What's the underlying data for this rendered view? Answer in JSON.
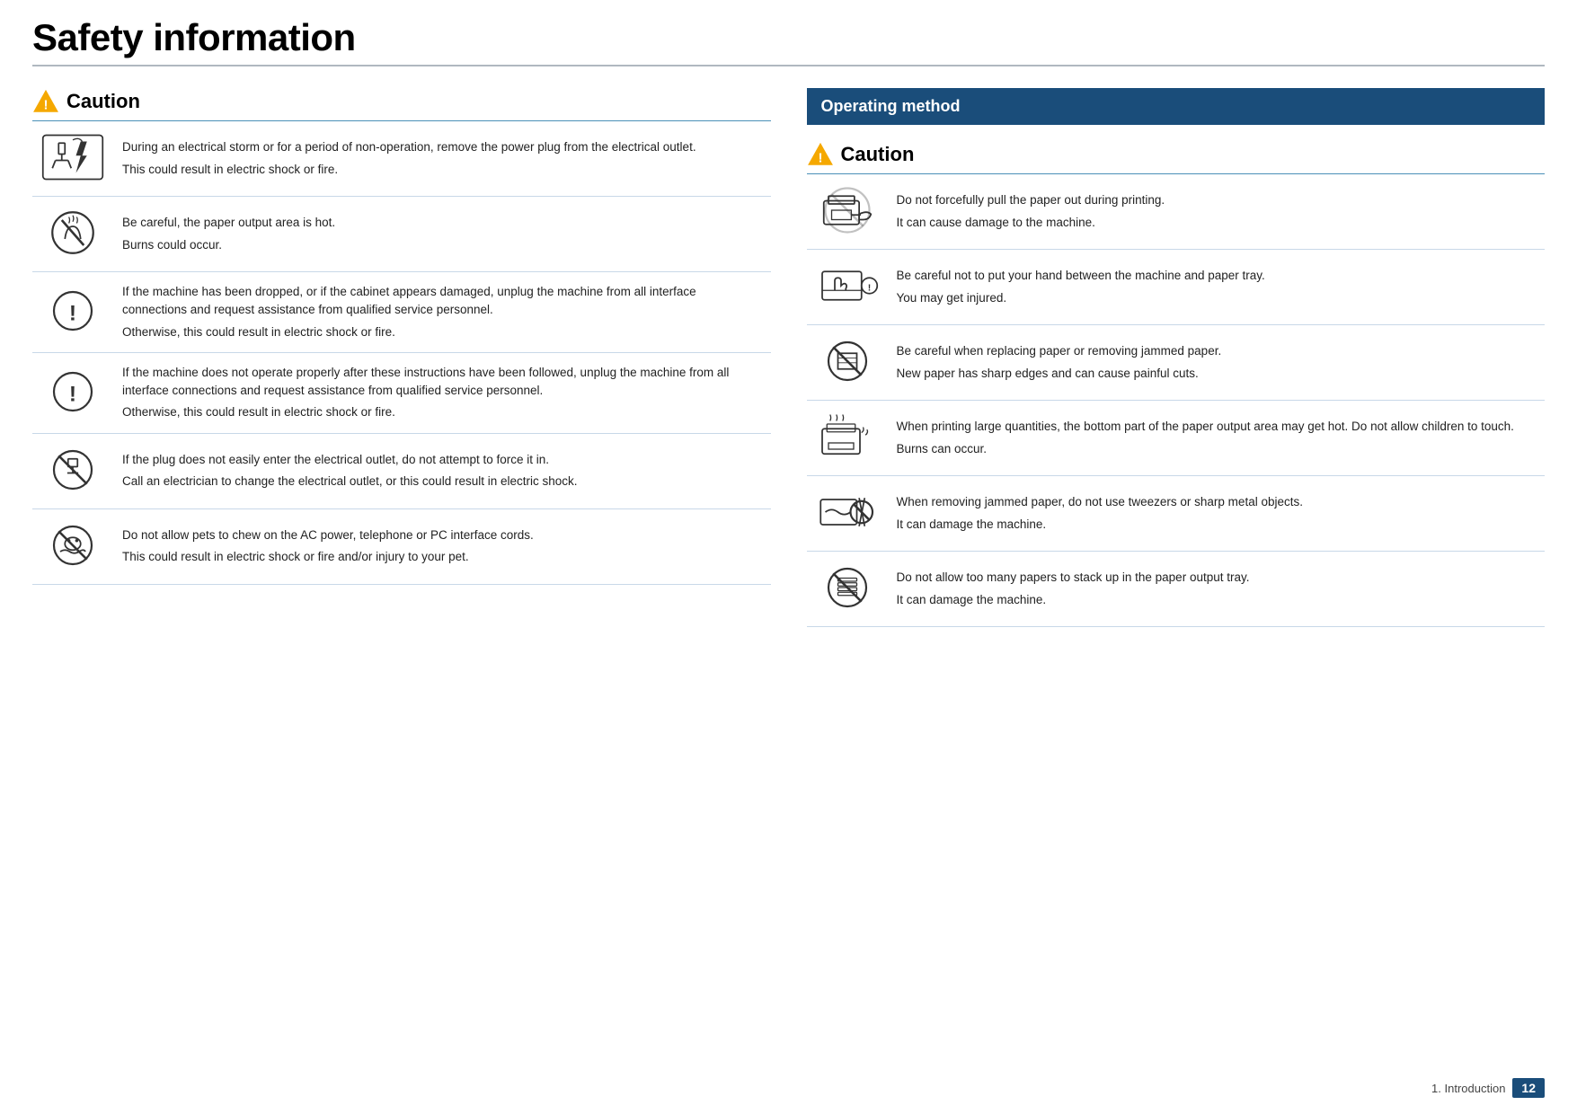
{
  "page": {
    "title": "Safety information",
    "divider": true,
    "footer": {
      "text": "1. Introduction",
      "page_number": "12"
    }
  },
  "left": {
    "caution_title": "Caution",
    "rows": [
      {
        "icon": "electrical-storm-icon",
        "text1": "During an electrical storm or for a period of non-operation, remove the power plug from the electrical outlet.",
        "text2": "This could result in electric shock or fire."
      },
      {
        "icon": "hot-output-icon",
        "text1": "Be careful, the paper output area is hot.",
        "text2": "Burns could occur."
      },
      {
        "icon": "exclamation-icon-1",
        "text1": "If the machine has been dropped, or if the cabinet appears damaged, unplug the machine from all interface connections and request assistance from qualified service personnel.",
        "text2": "Otherwise, this could result in electric shock or fire."
      },
      {
        "icon": "exclamation-icon-2",
        "text1": "If the machine does not operate properly after these instructions have been followed, unplug the machine from all interface connections and request assistance from qualified service personnel.",
        "text2": "Otherwise, this could result in electric shock or fire."
      },
      {
        "icon": "no-force-plug-icon",
        "text1": "If the plug does not easily enter the electrical outlet, do not attempt to force it in.",
        "text2": "Call an electrician to change the electrical outlet, or this could result in electric shock."
      },
      {
        "icon": "no-chew-icon",
        "text1": "Do not allow pets to chew on the AC power, telephone or PC interface cords.",
        "text2": "This could result in electric shock or fire and/or injury to your pet."
      }
    ]
  },
  "right": {
    "op_method_title": "Operating method",
    "caution_title": "Caution",
    "rows": [
      {
        "icon": "no-pull-paper-icon",
        "text1": "Do not forcefully pull the paper out during printing.",
        "text2": "It can cause damage to the machine."
      },
      {
        "icon": "hand-between-machine-icon",
        "text1": "Be careful not to put your hand between the machine and paper tray.",
        "text2": "You may get injured."
      },
      {
        "icon": "sharp-paper-icon",
        "text1": "Be careful when replacing paper or removing jammed paper.",
        "text2": "New paper has sharp edges and can cause painful cuts."
      },
      {
        "icon": "hot-output-large-icon",
        "text1": "When printing large quantities, the bottom part of the paper output area may get hot. Do not allow children to touch.",
        "text2": "Burns can occur."
      },
      {
        "icon": "no-tweezers-icon",
        "text1": "When removing jammed paper, do not use tweezers or sharp metal objects.",
        "text2": "It can damage the machine."
      },
      {
        "icon": "no-stack-icon",
        "text1": "Do not allow too many papers to stack up in the paper output tray.",
        "text2": "It can damage the machine."
      }
    ]
  }
}
